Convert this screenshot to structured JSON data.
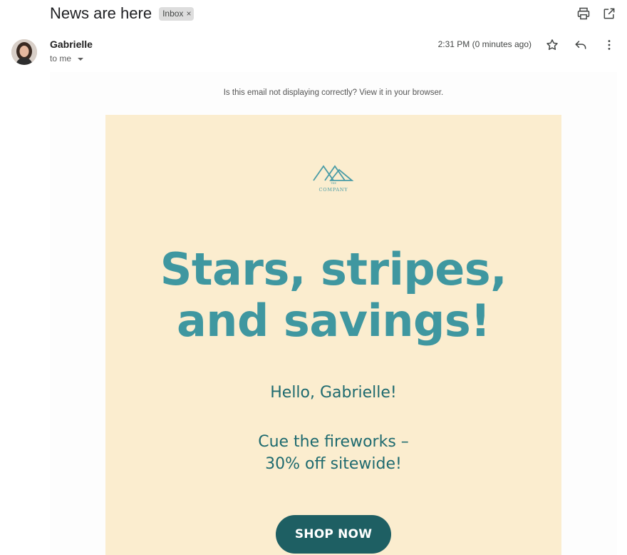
{
  "email": {
    "subject": "News are here",
    "label": "Inbox",
    "label_remove": "×",
    "sender_name": "Gabrielle",
    "recipient": "to me",
    "time": "2:31 PM (0 minutes ago)"
  },
  "icons": {
    "print": "printer-icon",
    "popout": "open-in-new-window-icon",
    "star": "star-icon",
    "reply": "reply-icon",
    "more": "more-vertical-icon"
  },
  "body": {
    "preheader": "Is this email not displaying correctly? View it in your browser.",
    "logo_small": "THE",
    "logo_text": "COMPANY",
    "headline_line1": "Stars, stripes,",
    "headline_line2": "and savings!",
    "greeting": "Hello, Gabrielle!",
    "offer_line1": "Cue the fireworks –",
    "offer_line2": "30% off sitewide!",
    "cta_label": "SHOP NOW"
  },
  "colors": {
    "card_background": "#fbedcf",
    "headline": "#3f97a0",
    "body_text": "#1e6a6f",
    "cta_background": "#1e5f63"
  }
}
